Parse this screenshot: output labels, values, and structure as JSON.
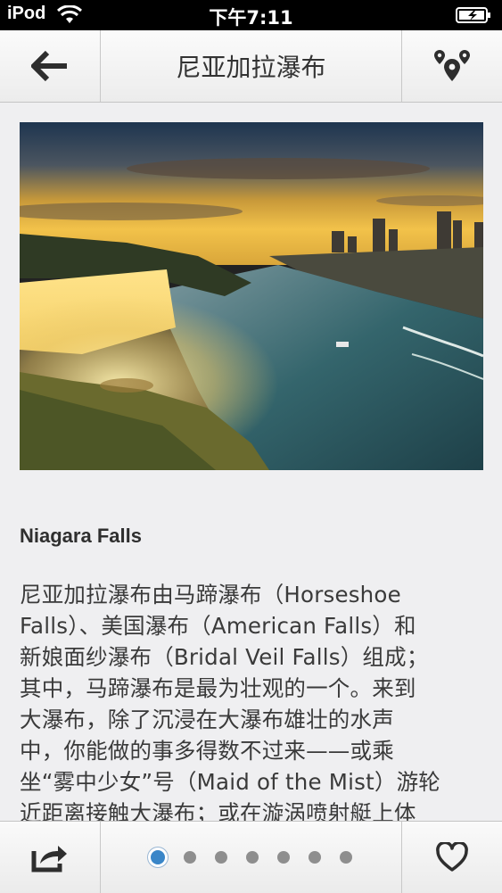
{
  "status_bar": {
    "carrier": "iPod",
    "time": "下午7:11"
  },
  "nav": {
    "title": "尼亚加拉瀑布"
  },
  "content": {
    "heading": "Niagara Falls",
    "body": "尼亚加拉瀑布由马蹄瀑布（Horseshoe\nFalls）、美国瀑布（American Falls）和\n新娘面纱瀑布（Bridal Veil Falls）组成；\n其中，马蹄瀑布是最为壮观的一个。来到\n大瀑布，除了沉浸在大瀑布雄壮的水声\n中，你能做的事多得数不过来——或乘\n坐“雾中少女”号（Maid of the Mist）游轮\n近距离接触大瀑布；或在漩涡喷射艇上体"
  },
  "pager": {
    "count": 7,
    "active_index": 0
  },
  "icons": {
    "back": "arrow-left-icon",
    "map": "map-pins-icon",
    "share": "share-icon",
    "favorite": "heart-icon"
  },
  "colors": {
    "accent": "#3a86c8"
  }
}
